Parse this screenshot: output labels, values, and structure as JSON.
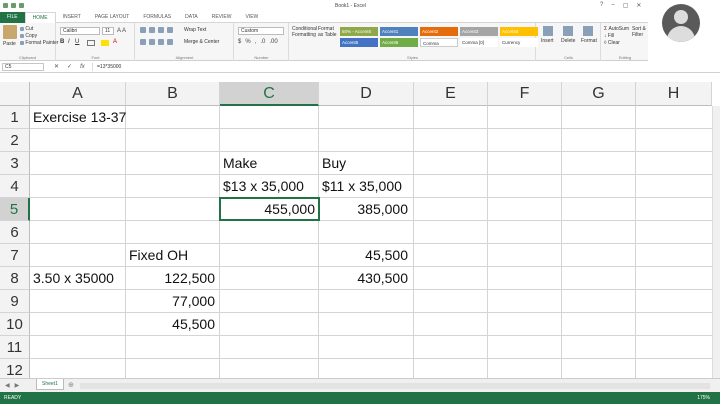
{
  "window": {
    "title": "Book1 - Excel"
  },
  "tabs": [
    "FILE",
    "HOME",
    "INSERT",
    "PAGE LAYOUT",
    "FORMULAS",
    "DATA",
    "REVIEW",
    "VIEW"
  ],
  "ribbon": {
    "paste": "Paste",
    "cut": "Cut",
    "copy": "Copy",
    "format_painter": "Format Painter",
    "font_name": "Calibri",
    "font_size": "11",
    "wrap_text": "Wrap Text",
    "merge_center": "Merge & Center",
    "number_format": "Custom",
    "conditional_formatting": "Conditional Formatting",
    "format_as_table": "Format as Table",
    "styles": [
      "60% - Accent6",
      "Accent1",
      "Accent2",
      "Accent3",
      "Accent4",
      "Accent5",
      "Accent6",
      "Comma",
      "Comma [0]",
      "Currency"
    ],
    "insert": "Insert",
    "delete": "Delete",
    "format": "Format",
    "autosum": "AutoSum",
    "fill": "Fill",
    "clear": "Clear",
    "sort_filter": "Sort & Filter",
    "find_select": "Find & Select",
    "groups": [
      "Clipboard",
      "Font",
      "Alignment",
      "Number",
      "Styles",
      "Cells",
      "Editing"
    ]
  },
  "formula_bar": {
    "name_box": "C5",
    "formula": "=13*35000"
  },
  "columns": [
    "A",
    "B",
    "C",
    "D",
    "E",
    "F",
    "G",
    "H"
  ],
  "selected_column": "C",
  "rows": [
    "1",
    "2",
    "3",
    "4",
    "5",
    "6",
    "7",
    "8",
    "9",
    "10",
    "11",
    "12"
  ],
  "selected_row": "5",
  "cells": {
    "A1": "Exercise 13-37",
    "C3": "Make",
    "D3": "Buy",
    "C4": "$13 x 35,000",
    "D4": "$11 x 35,000",
    "C5": "455,000",
    "D5": "385,000",
    "B7": "Fixed OH",
    "D7": "45,500",
    "A8": "3.50 x 35000",
    "B8": "122,500",
    "D8": "430,500",
    "B9": "77,000",
    "B10": "45,500"
  },
  "sheets": [
    "Sheet1"
  ],
  "status": {
    "ready": "READY",
    "zoom": "175%"
  },
  "colors": {
    "excel_green": "#217346"
  }
}
